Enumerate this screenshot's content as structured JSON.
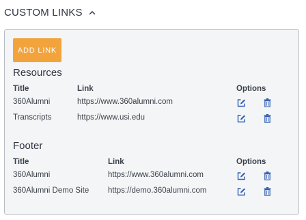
{
  "section": {
    "title": "CUSTOM LINKS"
  },
  "toolbar": {
    "add_label": "ADD LINK"
  },
  "groups": [
    {
      "title": "Resources",
      "columns": {
        "title": "Title",
        "link": "Link",
        "options": "Options"
      },
      "rows": [
        {
          "title": "360Alumni",
          "link": "https://www.360alumni.com"
        },
        {
          "title": "Transcripts",
          "link": "https://www.usi.edu"
        }
      ]
    },
    {
      "title": "Footer",
      "columns": {
        "title": "Title",
        "link": "Link",
        "options": "Options"
      },
      "rows": [
        {
          "title": "360Alumni",
          "link": "https://www.360alumni.com"
        },
        {
          "title": "360Alumni Demo Site",
          "link": "https://demo.360alumni.com"
        }
      ]
    }
  ],
  "colors": {
    "accent": "#f2a33c",
    "icon": "#2f5fb3",
    "panel_bg": "#f4f5f6",
    "panel_border": "#b7bcc2"
  },
  "icons": {
    "collapse": "chevron-up-icon",
    "edit": "edit-icon",
    "delete": "trash-icon"
  }
}
